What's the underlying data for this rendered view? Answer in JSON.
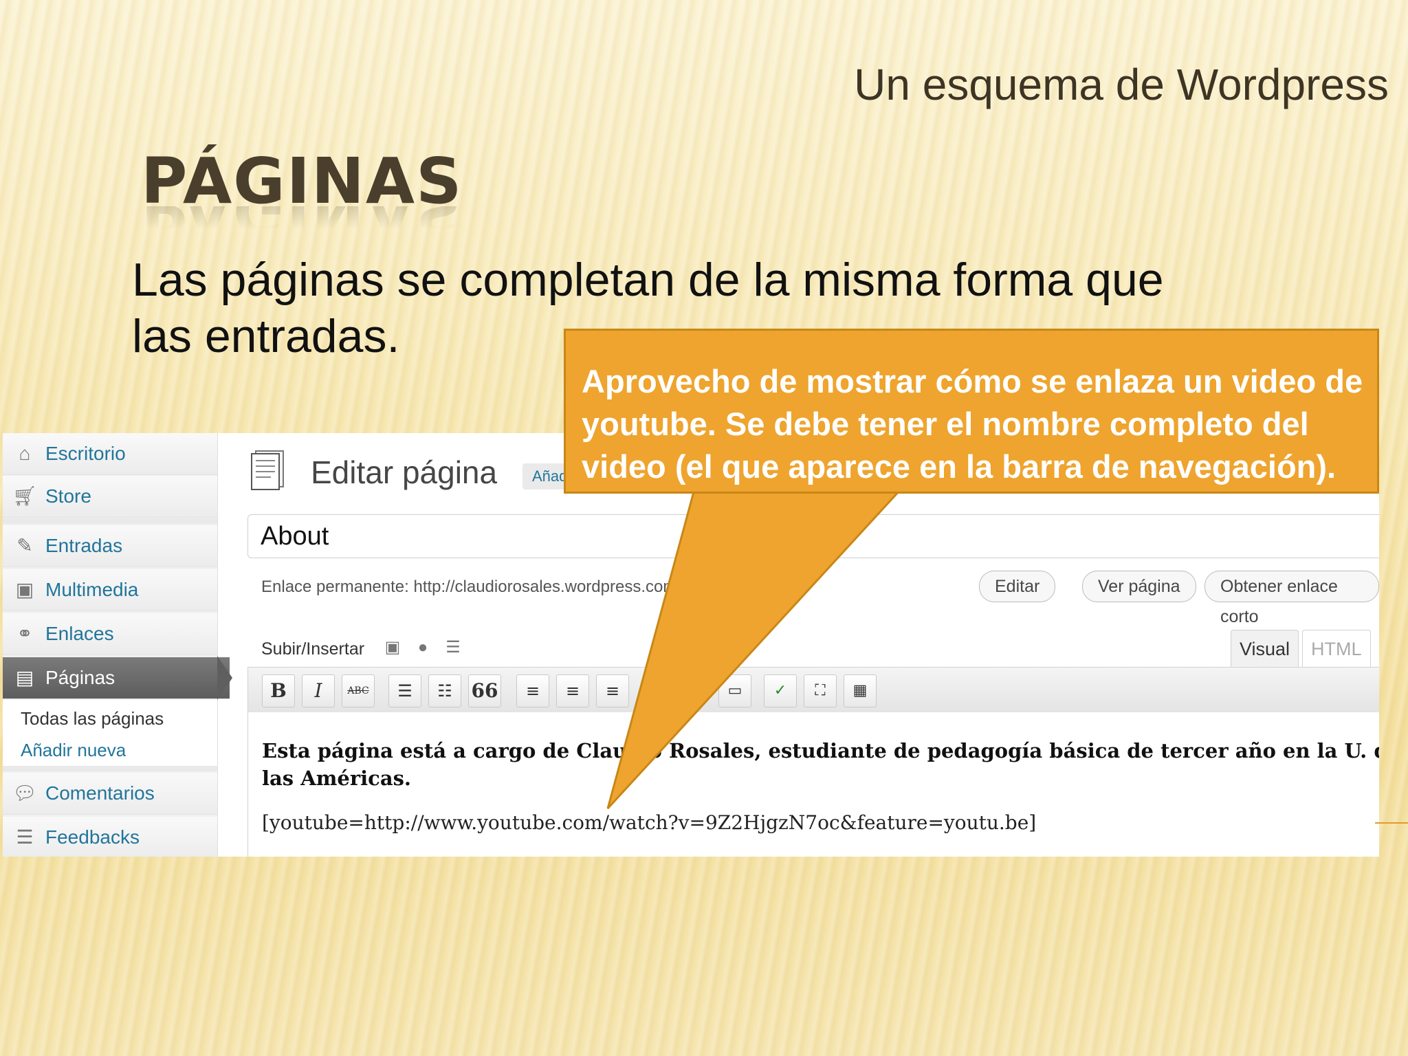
{
  "slide": {
    "subtitle": "Un esquema de Wordpress",
    "title": "PÁGINAS",
    "body": "Las páginas se completan de la misma forma que las entradas."
  },
  "callout": {
    "text": "Aprovecho de mostrar cómo se enlaza un video de youtube.  Se debe tener el nombre completo del video (el que aparece en la barra de navegación).",
    "color": "#eea42e"
  },
  "sidebar": {
    "items": [
      {
        "label": "Escritorio",
        "icon": "home-icon"
      },
      {
        "label": "Store",
        "icon": "cart-icon"
      },
      {
        "label": "Entradas",
        "icon": "pin-icon"
      },
      {
        "label": "Multimedia",
        "icon": "media-icon"
      },
      {
        "label": "Enlaces",
        "icon": "link-icon"
      },
      {
        "label": "Páginas",
        "icon": "pages-icon"
      },
      {
        "label": "Comentarios",
        "icon": "comment-icon"
      },
      {
        "label": "Feedbacks",
        "icon": "feedback-icon"
      }
    ],
    "submenu": [
      "Todas las páginas",
      "Añadir nueva"
    ]
  },
  "editor": {
    "heading": "Editar página",
    "add_new": "Añadir nueva",
    "title_value": "About",
    "permalink_label": "Enlace permanente:",
    "permalink_url": "http://claudiorosales.wordpress.com/about/",
    "edit_button": "Editar",
    "view_button": "Ver página",
    "shortlink_button": "Obtener enlace corto",
    "upload_label": "Subir/Insertar",
    "tab_visual": "Visual",
    "tab_html": "HTML",
    "content": "Esta página está a cargo de Claudio Rosales, estudiante de pedagogía básica de tercer año en la U. de las Américas.",
    "shortcode": "[youtube=http://www.youtube.com/watch?v=9Z2HjgzN7oc&feature=youtu.be]"
  },
  "toolbar": {
    "bold": "B",
    "italic": "I",
    "strike": "ABC",
    "quote": "66"
  }
}
